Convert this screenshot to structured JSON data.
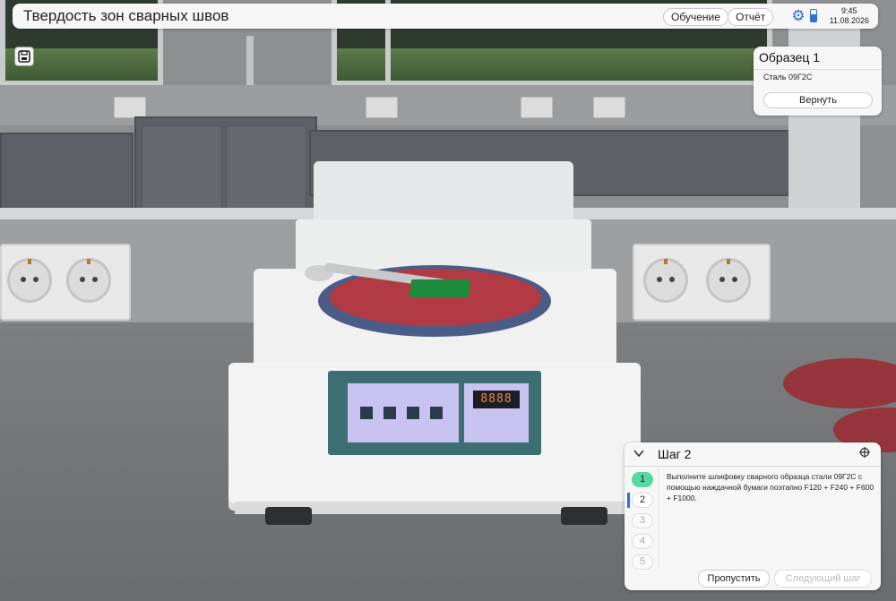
{
  "header": {
    "title": "Твердость зон сварных швов",
    "training_label": "Обучение",
    "report_label": "Отчёт",
    "time": "9:45",
    "date": "11.08.2026",
    "settings_icon": "gear-icon",
    "device_icon": "phone-icon",
    "accent_color": "#2f6fd6"
  },
  "toolbar": {
    "save_icon": "save-icon"
  },
  "sample_card": {
    "title": "Образец 1",
    "material": "Сталь 09Г2С",
    "return_label": "Вернуть"
  },
  "machine": {
    "display": "8888"
  },
  "step_panel": {
    "title": "Шаг 2",
    "instruction": "Выполните шлифовку сварного образца стали 09Г2С с помощью наждачной бумаги поэтапно F120 + F240 + F600 + F1000.",
    "steps": [
      {
        "label": "1",
        "state": "done"
      },
      {
        "label": "2",
        "state": "current"
      },
      {
        "label": "3",
        "state": "pending"
      },
      {
        "label": "4",
        "state": "pending"
      },
      {
        "label": "5",
        "state": "pending"
      }
    ],
    "skip_label": "Пропустить",
    "next_label": "Следующий шаг",
    "done_color": "#58d6a4"
  }
}
